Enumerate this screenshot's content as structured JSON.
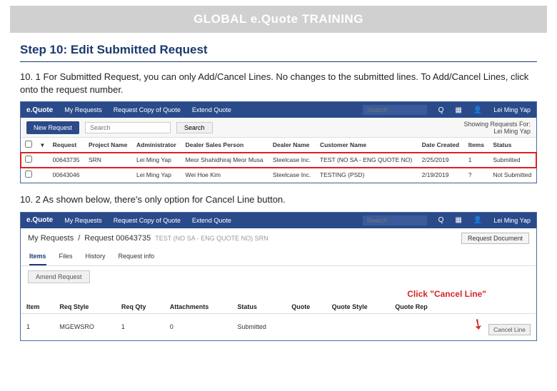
{
  "header": {
    "title": "GLOBAL e.Quote TRAINING"
  },
  "step": {
    "title": "Step 10: Edit Submitted Request"
  },
  "instr1": "10. 1  For Submitted Request, you can only Add/Cancel Lines. No changes to the submitted lines. To Add/Cancel Lines, click onto the request number.",
  "topbar": {
    "brand": "e.Quote",
    "nav1": "My Requests",
    "nav2": "Request Copy of Quote",
    "nav3": "Extend Quote",
    "search_ph": "Search",
    "user": "Lei Ming Yap"
  },
  "shot1": {
    "new_btn": "New Request",
    "search_ph": "Search",
    "search_btn": "Search",
    "showing": "Showing Requests For:",
    "showing_sub": "Lei Ming Yap",
    "headers": {
      "req": "Request",
      "proj": "Project Name",
      "admin": "Administrator",
      "dsp": "Dealer Sales Person",
      "dealer": "Dealer Name",
      "cust": "Customer Name",
      "date": "Date Created",
      "items": "Items",
      "status": "Status"
    },
    "rows": [
      {
        "req": "00643735",
        "proj": "SRN",
        "admin": "Lei Ming Yap",
        "dsp": "Meor Shahidhiraj Meor Musa",
        "dealer": "Steelcase Inc.",
        "cust": "TEST (NO SA - ENG QUOTE NO)",
        "date": "2/25/2019",
        "items": "1",
        "status": "Submitted"
      },
      {
        "req": "00643046",
        "proj": "",
        "admin": "Lei Ming Yap",
        "dsp": "Wei Hoe Kim",
        "dealer": "Steelcase Inc.",
        "cust": "TESTING (PSD)",
        "date": "2/19/2019",
        "items": "?",
        "status": "Not Submitted"
      }
    ]
  },
  "instr2": "10. 2  As shown below, there's only option for Cancel Line button.",
  "shot2": {
    "crumb1": "My Requests",
    "crumb2": "Request 00643735",
    "crumb_detail": "TEST (NO SA - ENG QUOTE NO)   SRN",
    "reqdoc": "Request Document",
    "tabs": {
      "t1": "Items",
      "t2": "Files",
      "t3": "History",
      "t4": "Request info"
    },
    "amend": "Amend Request",
    "headers": {
      "item": "Item",
      "reqstyle": "Req Style",
      "reqqty": "Req Qty",
      "att": "Attachments",
      "status": "Status",
      "quote": "Quote",
      "qstyle": "Quote Style",
      "qrep": "Quote Rep"
    },
    "row": {
      "item": "1",
      "reqstyle": "MGEWSRO",
      "reqqty": "1",
      "att": "0",
      "status": "Submitted",
      "quote": "",
      "qstyle": "",
      "qrep": ""
    },
    "cancel": "Cancel Line",
    "callout": "Click \"Cancel Line\""
  }
}
